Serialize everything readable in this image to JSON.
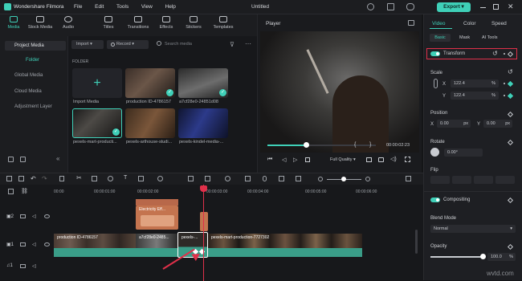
{
  "app": {
    "name": "Wondershare Filmora",
    "project": "Untitled",
    "export_label": "Export"
  },
  "menu": [
    "File",
    "Edit",
    "Tools",
    "View",
    "Help"
  ],
  "media_tabs": [
    {
      "label": "Media",
      "icon": "media-icon"
    },
    {
      "label": "Stock Media",
      "icon": "cloud-icon"
    },
    {
      "label": "Audio",
      "icon": "music-icon"
    },
    {
      "label": "Titles",
      "icon": "titles-icon"
    },
    {
      "label": "Transitions",
      "icon": "transition-icon"
    },
    {
      "label": "Effects",
      "icon": "effects-icon"
    },
    {
      "label": "Stickers",
      "icon": "sticker-icon"
    },
    {
      "label": "Templates",
      "icon": "template-icon"
    }
  ],
  "sidebar": {
    "project_media": "Project Media",
    "folder": "Folder",
    "items": [
      "Global Media",
      "Cloud Media",
      "Adjustment Layer"
    ]
  },
  "media_toolbar": {
    "import": "Import",
    "record": "Record",
    "search_placeholder": "Search media"
  },
  "folder_label": "FOLDER",
  "media_items": [
    {
      "label": "Import Media"
    },
    {
      "label": "production ID-4786157"
    },
    {
      "label": "a7cf28e0-24851d08"
    },
    {
      "label": "pexels-mart-producti..."
    },
    {
      "label": "pexels-arthouse-studi..."
    },
    {
      "label": "pexels-kindel-media-..."
    }
  ],
  "player": {
    "title": "Player",
    "time": "00:00:02:23",
    "quality": "Full Quality"
  },
  "props": {
    "tabs": [
      "Video",
      "Color",
      "Speed"
    ],
    "subtabs": [
      "Basic",
      "Mask",
      "AI Tools"
    ],
    "transform": "Transform",
    "scale": {
      "label": "Scale",
      "x_label": "X",
      "x": "122.4",
      "y_label": "Y",
      "y": "122.4",
      "unit": "%"
    },
    "position": {
      "label": "Position",
      "x_label": "X",
      "x": "0.00",
      "y_label": "Y",
      "y": "0.00",
      "unit": "px"
    },
    "rotate": {
      "label": "Rotate",
      "value": "0.00°"
    },
    "flip": "Flip",
    "compositing": "Compositing",
    "blend_mode": {
      "label": "Blend Mode",
      "value": "Normal"
    },
    "opacity": {
      "label": "Opacity",
      "value": "100.0",
      "unit": "%"
    }
  },
  "timeline": {
    "ruler": [
      "00:00",
      "00:00:01:00",
      "00:00:02:00",
      "00:00:03:00",
      "00:00:04:00",
      "00:00:05:00",
      "00:00:06:00"
    ],
    "title_clip": "Electricity Eff...",
    "clips": [
      "production ID-4786157",
      "a7cf28e0-2485...",
      "pexels-...",
      "pexels-mart-production-7727302"
    ],
    "tracks": [
      "2",
      "1",
      "1"
    ]
  },
  "watermark": "wvtd.com"
}
